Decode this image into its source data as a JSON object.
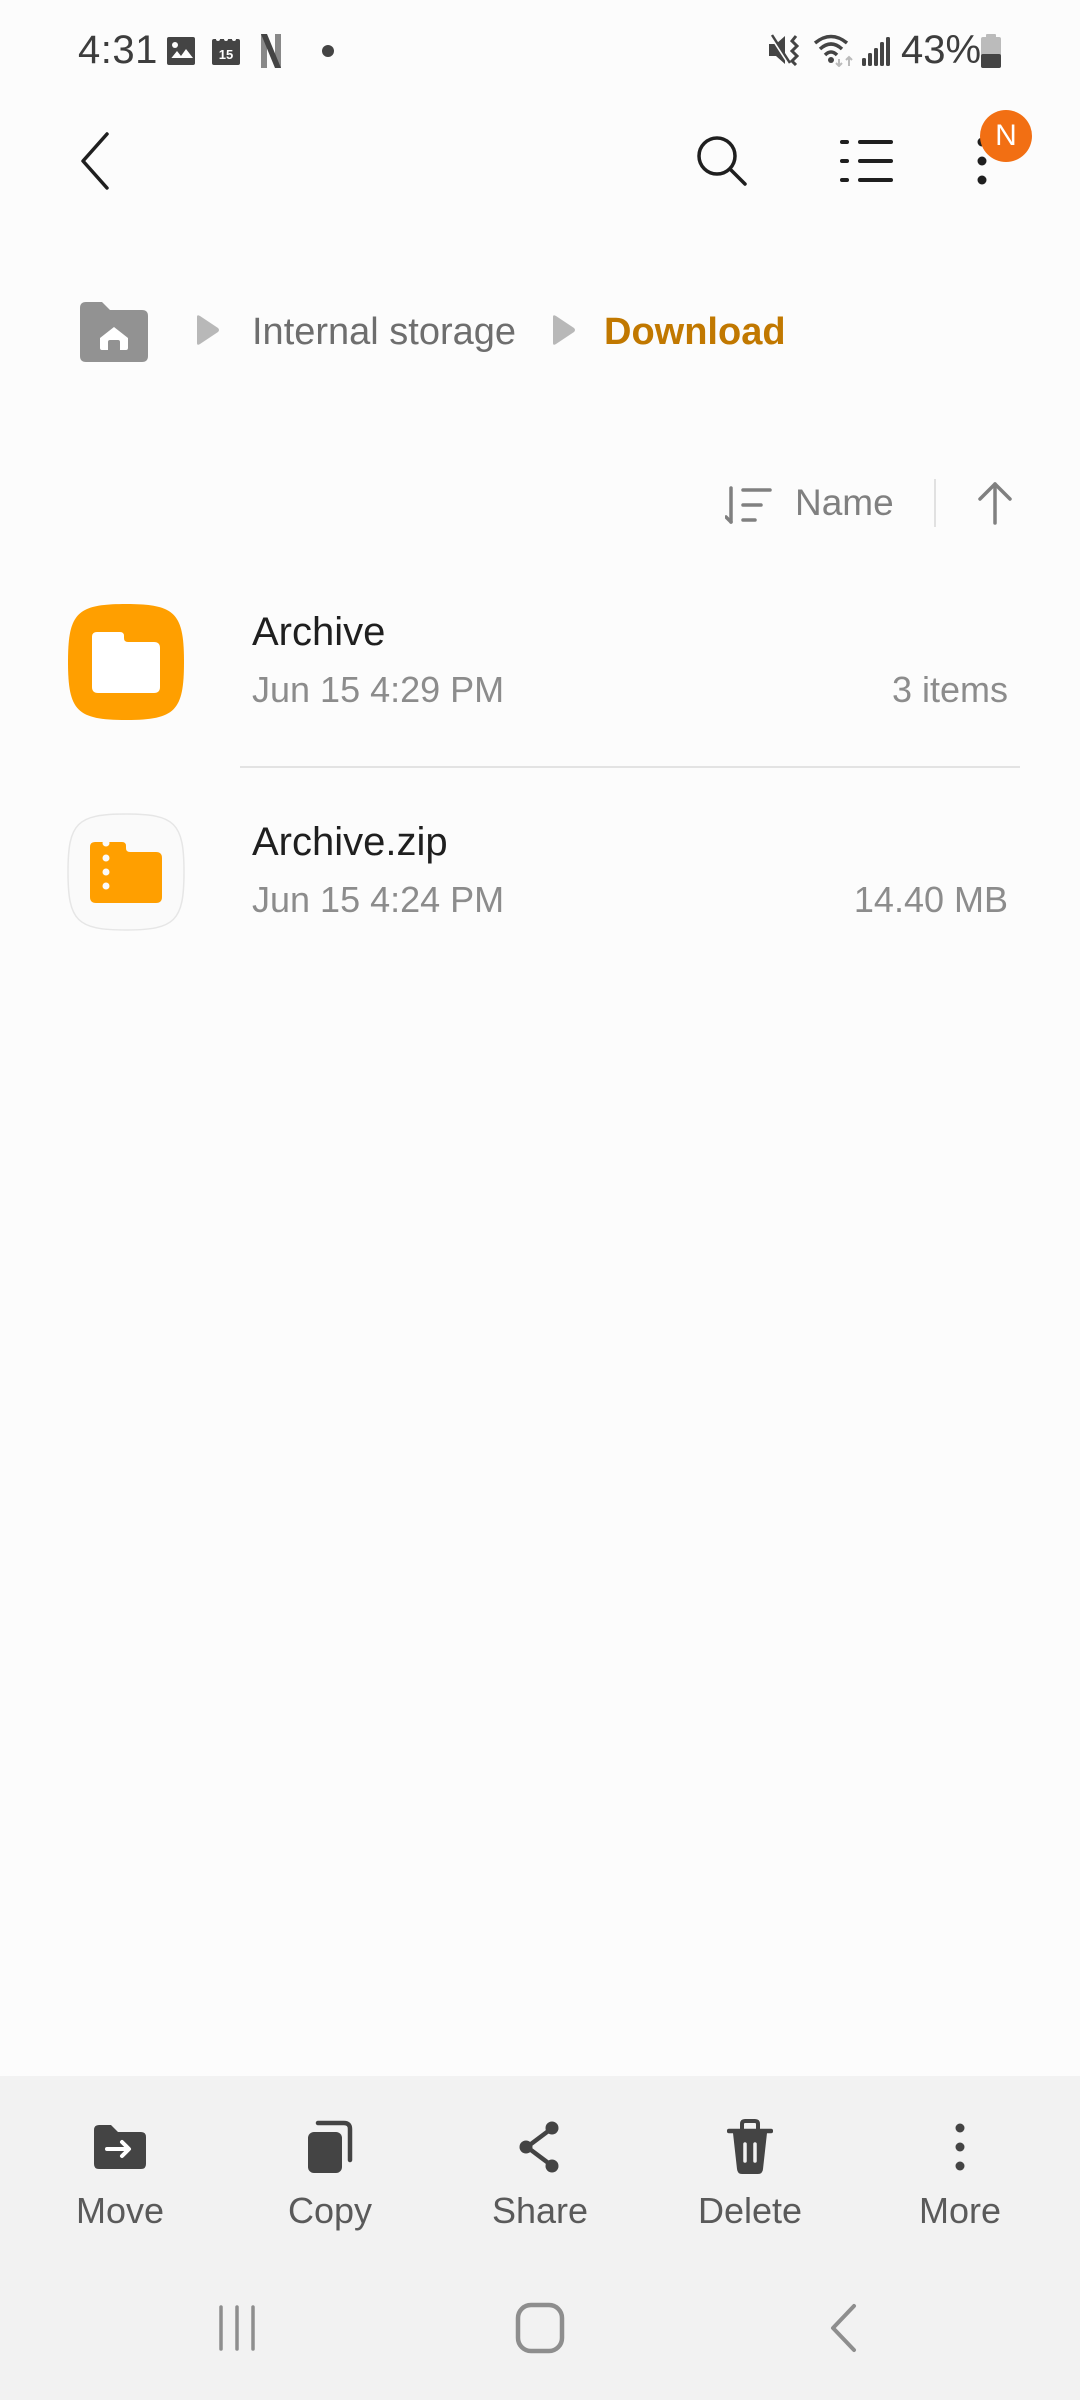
{
  "status_bar": {
    "time": "4:31",
    "notification_icons": [
      "gallery-icon",
      "calendar-icon",
      "netflix-icon",
      "dot-icon"
    ],
    "calendar_day": "15",
    "system_icons": [
      "mute-vibrate-icon",
      "wifi-icon",
      "signal-icon",
      "battery-icon"
    ],
    "battery_percent_text": "43%",
    "battery_level": 0.43
  },
  "toolbar": {
    "back_icon": "chevron-left-icon",
    "search_icon": "search-icon",
    "view_icon": "list-view-icon",
    "more_icon": "more-vertical-icon",
    "badge_text": "N",
    "badge_color": "#f26f13"
  },
  "breadcrumb": {
    "home_icon": "home-folder-icon",
    "items": [
      {
        "label": "Internal storage",
        "current": false
      },
      {
        "label": "Download",
        "current": true
      }
    ],
    "accent_color": "#c17800"
  },
  "sort": {
    "label": "Name",
    "direction": "ascending"
  },
  "files": [
    {
      "name": "Archive",
      "type": "folder",
      "date": "Jun 15 4:29 PM",
      "meta": "3 items"
    },
    {
      "name": "Archive.zip",
      "type": "zip",
      "date": "Jun 15 4:24 PM",
      "meta": "14.40 MB"
    }
  ],
  "actions": [
    {
      "label": "Move",
      "icon": "move-icon"
    },
    {
      "label": "Copy",
      "icon": "copy-icon"
    },
    {
      "label": "Share",
      "icon": "share-icon"
    },
    {
      "label": "Delete",
      "icon": "delete-icon"
    },
    {
      "label": "More",
      "icon": "more-vertical-icon"
    }
  ],
  "nav_bar": {
    "recents_icon": "recents-icon",
    "home_icon": "home-button-icon",
    "back_icon": "back-icon"
  }
}
